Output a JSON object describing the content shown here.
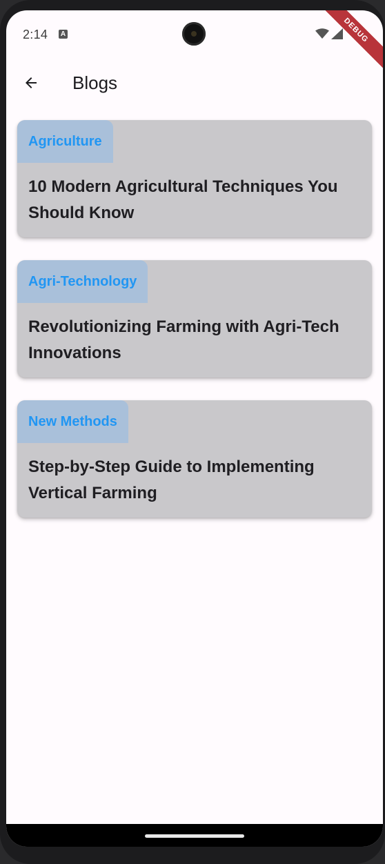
{
  "status_bar": {
    "time": "2:14",
    "notification_icon": "A",
    "debug_label": "DEBUG"
  },
  "app_bar": {
    "back_icon": "arrow-left",
    "title": "Blogs"
  },
  "blogs": [
    {
      "category": "Agriculture",
      "title": "10 Modern Agricultural Techniques You Should Know"
    },
    {
      "category": "Agri-Technology",
      "title": "Revolutionizing Farming with Agri-Tech Innovations"
    },
    {
      "category": "New Methods",
      "title": "Step-by-Step Guide to Implementing Vertical Farming"
    }
  ],
  "colors": {
    "tag_text": "#2196f3",
    "tag_background": "#a9c0da",
    "card_background": "#c9c8cb",
    "debug_banner": "#b8343a"
  }
}
